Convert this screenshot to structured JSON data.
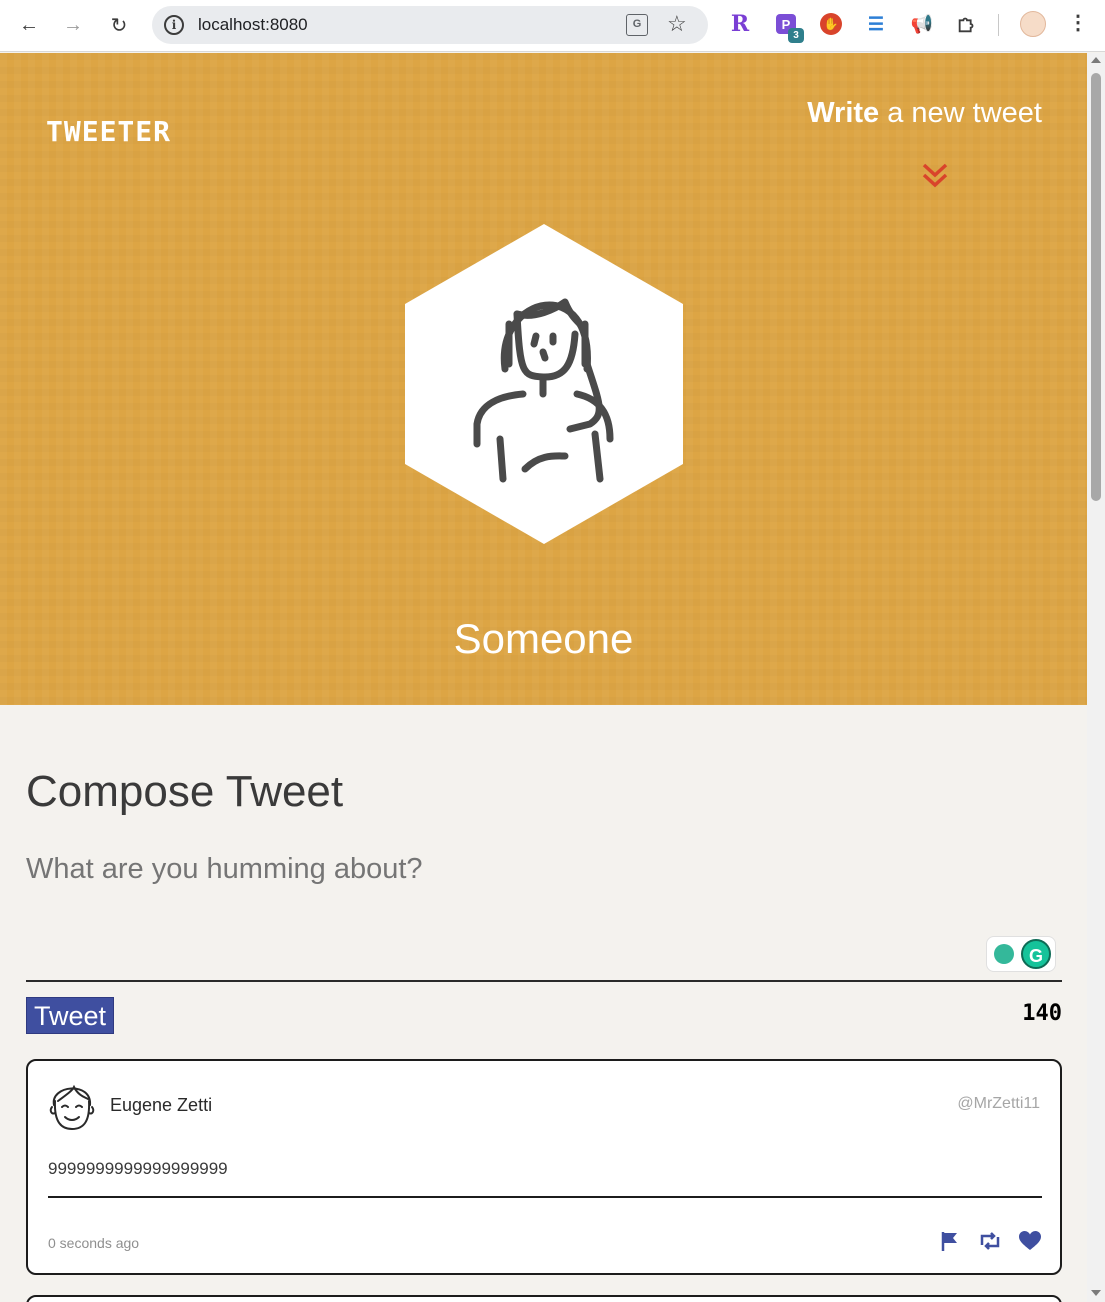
{
  "browser": {
    "url": "localhost:8080",
    "extension_badge": "3",
    "icons": [
      "back-icon",
      "forward-icon",
      "reload-icon",
      "site-info-icon",
      "translate-icon",
      "bookmark-star-icon",
      "extensions-puzzle-icon",
      "menu-kebab-icon"
    ]
  },
  "header": {
    "brand": "TWEETER",
    "write_bold": "Write",
    "write_rest": " a new tweet",
    "username": "Someone",
    "colors": {
      "background": "#dda544",
      "chevron": "#d9442b"
    }
  },
  "compose": {
    "title": "Compose Tweet",
    "placeholder": "What are you humming about?",
    "button_label": "Tweet",
    "counter": "140"
  },
  "tweets": [
    {
      "name": "Eugene Zetti",
      "handle": "@MrZetti11",
      "content": "9999999999999999999",
      "time": "0 seconds ago",
      "actions": [
        "flag-icon",
        "retweet-icon",
        "heart-icon"
      ]
    }
  ],
  "colors": {
    "accent": "#3f4fa0",
    "page": "#f4f2ee"
  }
}
